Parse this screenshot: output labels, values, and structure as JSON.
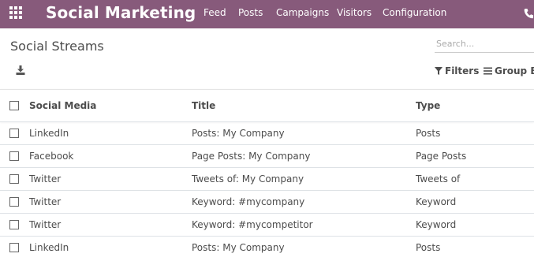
{
  "navbar": {
    "brand": "Social Marketing",
    "menu": [
      "Feed",
      "Posts",
      "Campaigns",
      "Visitors",
      "Configuration"
    ],
    "color": "#875a7b"
  },
  "control_panel": {
    "title": "Social Streams",
    "search_placeholder": "Search...",
    "filters_label": "Filters",
    "group_by_label": "Group By"
  },
  "table": {
    "columns": [
      "Social Media",
      "Title",
      "Type"
    ],
    "rows": [
      {
        "media": "LinkedIn",
        "title": "Posts: My Company",
        "type": "Posts"
      },
      {
        "media": "Facebook",
        "title": "Page Posts: My Company",
        "type": "Page Posts"
      },
      {
        "media": "Twitter",
        "title": "Tweets of: My Company",
        "type": "Tweets of"
      },
      {
        "media": "Twitter",
        "title": "Keyword: #mycompany",
        "type": "Keyword"
      },
      {
        "media": "Twitter",
        "title": "Keyword: #mycompetitor",
        "type": "Keyword"
      },
      {
        "media": "LinkedIn",
        "title": "Posts: My Company",
        "type": "Posts"
      }
    ]
  },
  "icons": {
    "apps": "apps-grid-icon",
    "phone": "phone-icon",
    "download": "download-icon",
    "filter": "filter-icon",
    "group_by": "list-icon"
  }
}
